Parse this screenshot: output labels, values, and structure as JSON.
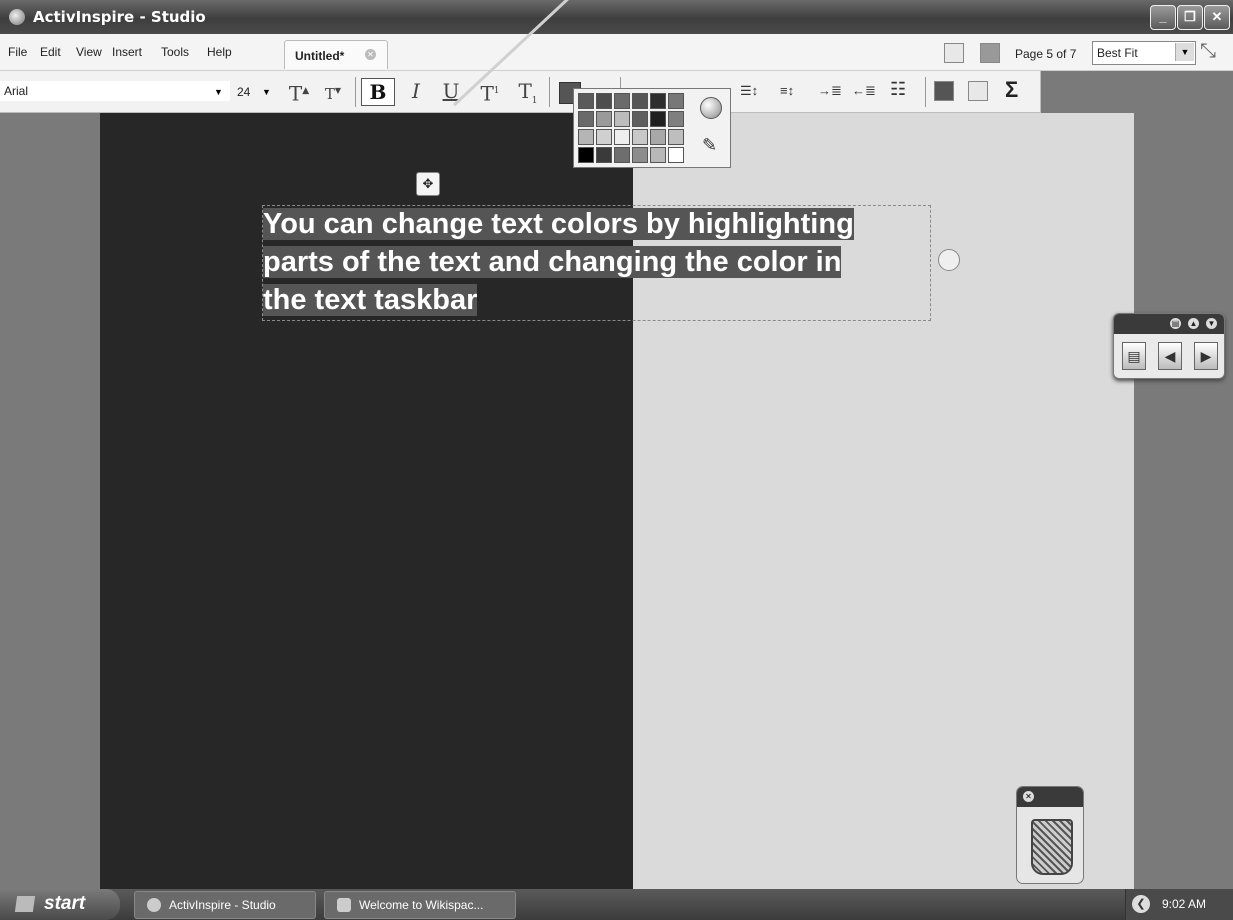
{
  "window": {
    "title": "ActivInspire - Studio"
  },
  "menu": {
    "items": [
      "File",
      "Edit",
      "View",
      "Insert",
      "Tools",
      "Help"
    ]
  },
  "tabs": [
    {
      "label": "Untitled*",
      "active": true
    }
  ],
  "page_indicator": "Page 5 of 7",
  "zoom": {
    "selected": "Best Fit"
  },
  "text_toolbar": {
    "font": "Arial",
    "size": "24"
  },
  "color_palette": {
    "swatches": [
      "#5a5a5a",
      "#4d4d4d",
      "#6b6b6b",
      "#555555",
      "#2e2e2e",
      "#777777",
      "#6a6a6a",
      "#9a9a9a",
      "#bcbcbc",
      "#5e5e5e",
      "#1f1f1f",
      "#7f7f7f",
      "#b5b5b5",
      "#d0d0d0",
      "#eeeeee",
      "#c8c8c8",
      "#a8a8a8",
      "#bebebe",
      "#000000",
      "#3a3a3a",
      "#6e6e6e",
      "#8c8c8c",
      "#b8b8b8",
      "#ffffff"
    ],
    "current_color": "#555555"
  },
  "canvas": {
    "text": {
      "line1": "You can change text colors by highlighting",
      "line2": "parts of the text and changing the color in",
      "line3": "the text  taskbar"
    },
    "dark_panel_color": "#272727",
    "light_panel_color": "#dadada"
  },
  "taskbar": {
    "start_label": "start",
    "tasks": [
      "ActivInspire - Studio",
      "Welcome to Wikispac..."
    ],
    "clock": "9:02 AM"
  }
}
